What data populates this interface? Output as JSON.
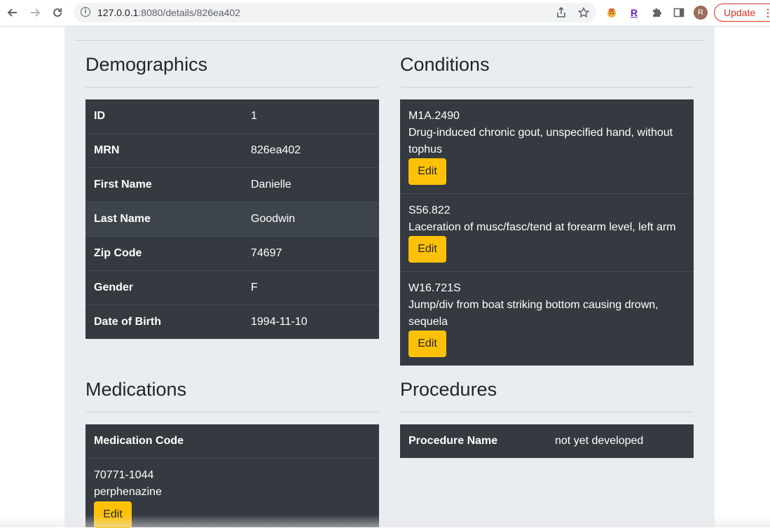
{
  "browser": {
    "url_host": "127.0.0.1",
    "url_rest": ":8080/details/826ea402",
    "update_label": "Update",
    "update_menu": "⋮",
    "profile_initial": "R",
    "ext_r_label": "R",
    "info_symbol": "i",
    "accent_color": "#d93025"
  },
  "demographics": {
    "title": "Demographics",
    "rows": [
      {
        "label": "ID",
        "value": "1"
      },
      {
        "label": "MRN",
        "value": "826ea402"
      },
      {
        "label": "First Name",
        "value": "Danielle"
      },
      {
        "label": "Last Name",
        "value": "Goodwin"
      },
      {
        "label": "Zip Code",
        "value": "74697"
      },
      {
        "label": "Gender",
        "value": "F"
      },
      {
        "label": "Date of Birth",
        "value": "1994-11-10"
      }
    ]
  },
  "conditions": {
    "title": "Conditions",
    "items": [
      {
        "code": "M1A.2490",
        "description": "Drug-induced chronic gout, unspecified hand, without tophus",
        "edit_label": "Edit"
      },
      {
        "code": "S56.822",
        "description": "Laceration of musc/fasc/tend at forearm level, left arm",
        "edit_label": "Edit"
      },
      {
        "code": "W16.721S",
        "description": "Jump/div from boat striking bottom causing drown, sequela",
        "edit_label": "Edit"
      }
    ]
  },
  "medications": {
    "title": "Medications",
    "header": "Medication Code",
    "items": [
      {
        "code": "70771-1044",
        "name": "perphenazine",
        "edit_label": "Edit"
      }
    ]
  },
  "procedures": {
    "title": "Procedures",
    "header": "Procedure Name",
    "value": "not yet developed"
  },
  "colors": {
    "table_dark": "#343a40",
    "edit_button": "#ffc107",
    "page_bg": "#e9ecf1"
  }
}
